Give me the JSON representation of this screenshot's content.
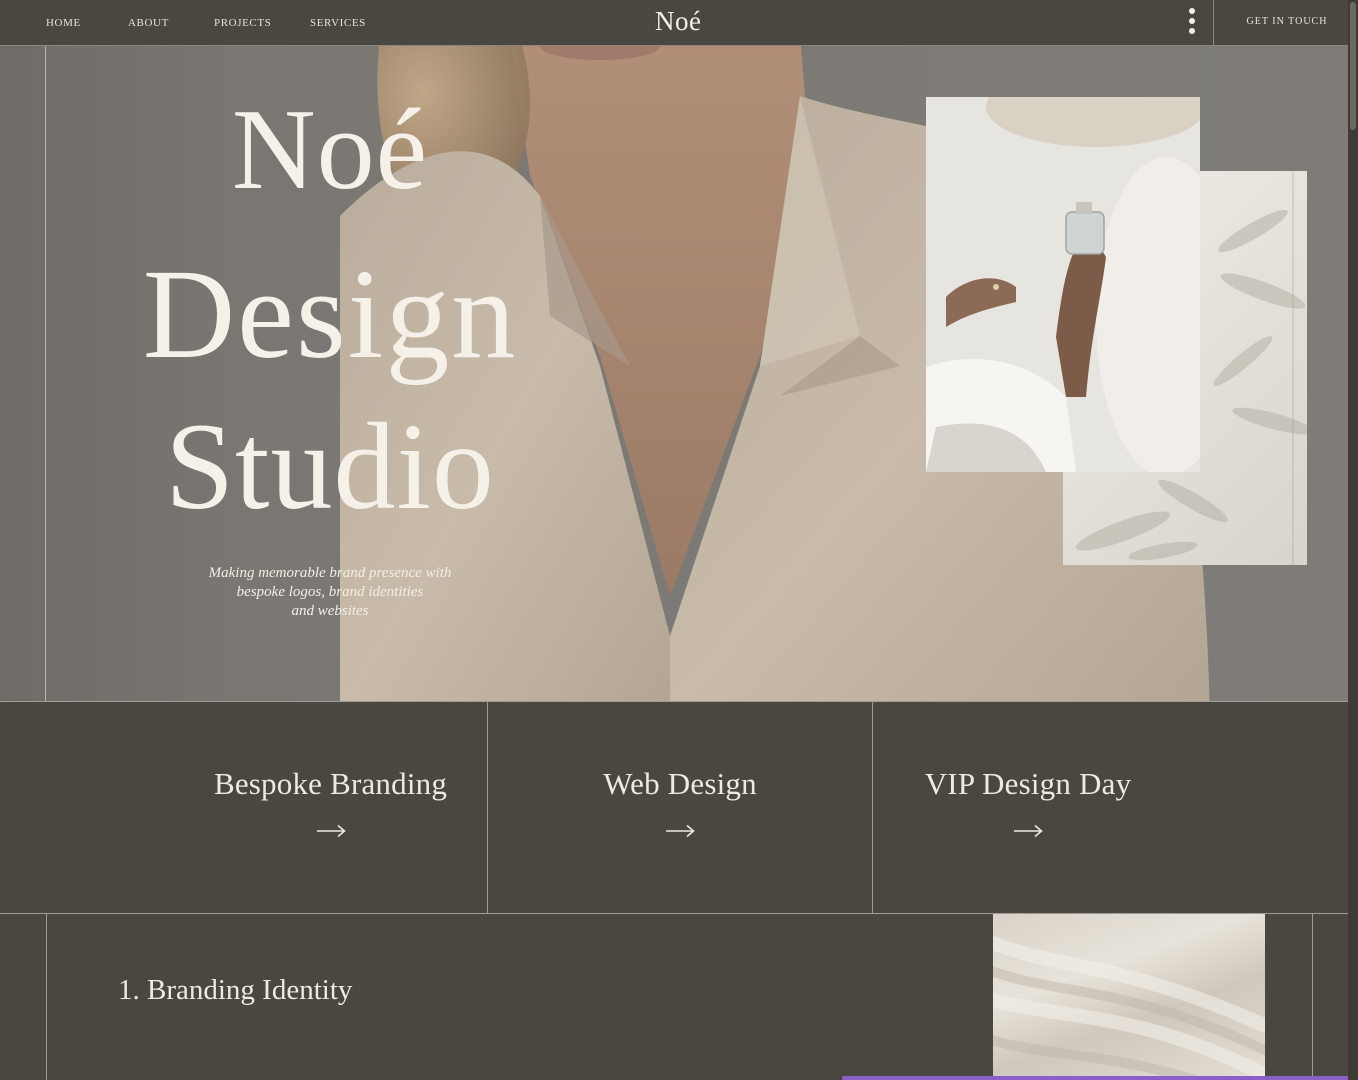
{
  "nav": {
    "links": [
      "HOME",
      "ABOUT",
      "PROJECTS",
      "SERVICES"
    ],
    "logo": "Noé",
    "cta": "GET IN TOUCH"
  },
  "hero": {
    "title_lines": [
      "Noé",
      "Design",
      "Studio"
    ],
    "tagline_lines": [
      "Making memorable brand presence with",
      "bespoke logos, brand identities",
      "and websites"
    ]
  },
  "services": [
    {
      "title": "Bespoke Branding",
      "arrow": "→"
    },
    {
      "title": "Web Design",
      "arrow": "→"
    },
    {
      "title": "VIP Design Day",
      "arrow": "→"
    }
  ],
  "branding": {
    "title": "1. Branding Identity"
  },
  "colors": {
    "background": "#4a4640",
    "text": "#f3eee6",
    "accent_bar": "#8b5fc9"
  }
}
